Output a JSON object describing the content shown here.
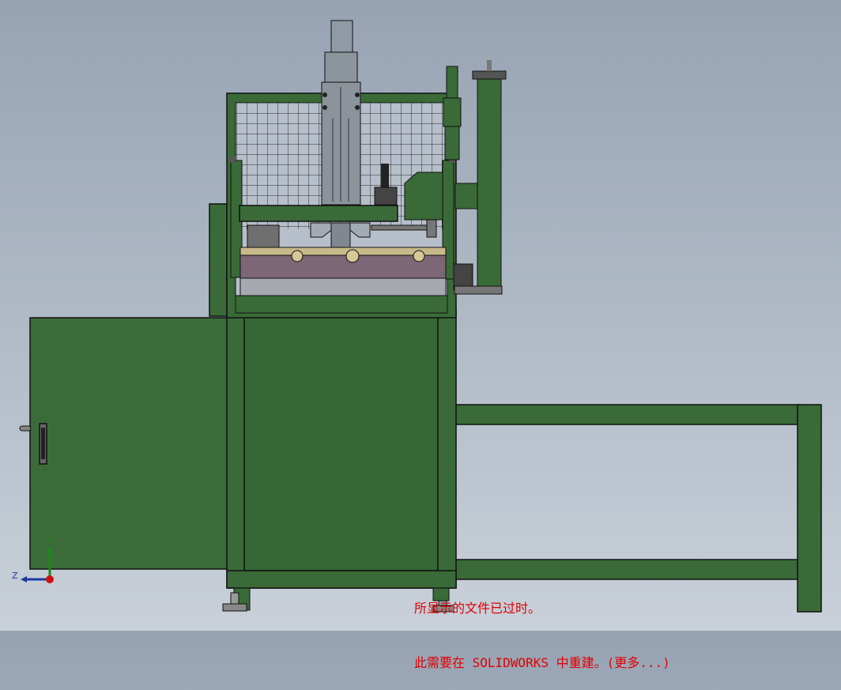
{
  "triad": {
    "y_label": "Y",
    "z_label": "Z"
  },
  "notice": {
    "line1": "所显示的文件已过时。",
    "line2": "此需要在 SOLIDWORKS 中重建。(更多...)"
  },
  "colors": {
    "machine_green": "#3a6a38",
    "machine_green_dark": "#2d5a2c",
    "fixture_purple": "#7c6574",
    "steel": "#8c939b",
    "notice_red": "#e00000"
  }
}
